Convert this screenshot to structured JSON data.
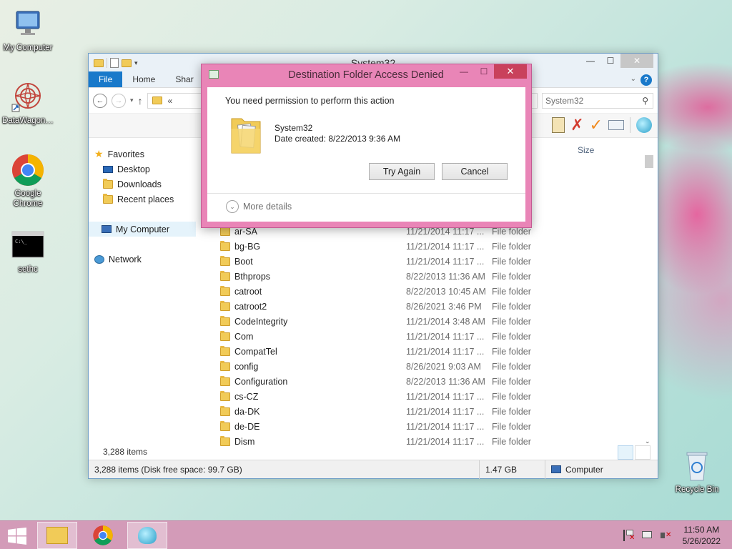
{
  "desktop": {
    "icons": [
      {
        "label": "My Computer",
        "icon": "computer-icon"
      },
      {
        "label": "DataWagon…",
        "icon": "datawagon-icon"
      },
      {
        "label": "Google Chrome",
        "icon": "chrome-icon"
      },
      {
        "label": "sethc",
        "icon": "console-icon"
      },
      {
        "label": "Recycle Bin",
        "icon": "recycle-bin-icon"
      }
    ]
  },
  "explorer": {
    "title": "System32",
    "tabs": [
      "File",
      "Home",
      "Shar"
    ],
    "address_prefix": "«",
    "search_placeholder": "System32",
    "column_size": "Size",
    "nav": {
      "favorites": "Favorites",
      "desktop": "Desktop",
      "downloads": "Downloads",
      "recent": "Recent places",
      "computer": "My Computer",
      "network": "Network"
    },
    "files": [
      {
        "name": "ar-SA",
        "date": "11/21/2014 11:17 ...",
        "type": "File folder"
      },
      {
        "name": "bg-BG",
        "date": "11/21/2014 11:17 ...",
        "type": "File folder"
      },
      {
        "name": "Boot",
        "date": "11/21/2014 11:17 ...",
        "type": "File folder"
      },
      {
        "name": "Bthprops",
        "date": "8/22/2013 11:36 AM",
        "type": "File folder"
      },
      {
        "name": "catroot",
        "date": "8/22/2013 10:45 AM",
        "type": "File folder"
      },
      {
        "name": "catroot2",
        "date": "8/26/2021 3:46 PM",
        "type": "File folder"
      },
      {
        "name": "CodeIntegrity",
        "date": "11/21/2014 3:48 AM",
        "type": "File folder"
      },
      {
        "name": "Com",
        "date": "11/21/2014 11:17 ...",
        "type": "File folder"
      },
      {
        "name": "CompatTel",
        "date": "11/21/2014 11:17 ...",
        "type": "File folder"
      },
      {
        "name": "config",
        "date": "8/26/2021 9:03 AM",
        "type": "File folder"
      },
      {
        "name": "Configuration",
        "date": "8/22/2013 11:36 AM",
        "type": "File folder"
      },
      {
        "name": "cs-CZ",
        "date": "11/21/2014 11:17 ...",
        "type": "File folder"
      },
      {
        "name": "da-DK",
        "date": "11/21/2014 11:17 ...",
        "type": "File folder"
      },
      {
        "name": "de-DE",
        "date": "11/21/2014 11:17 ...",
        "type": "File folder"
      },
      {
        "name": "Dism",
        "date": "11/21/2014 11:17 ...",
        "type": "File folder"
      }
    ],
    "item_count": "3,288 items",
    "status": {
      "summary": "3,288 items (Disk free space: 99.7 GB)",
      "size": "1.47 GB",
      "location": "Computer"
    }
  },
  "dialog": {
    "title": "Destination Folder Access Denied",
    "message": "You need permission to perform this action",
    "folder_name": "System32",
    "date_created": "Date created: 8/22/2013 9:36 AM",
    "try_again": "Try Again",
    "cancel": "Cancel",
    "more_details": "More details"
  },
  "taskbar": {
    "time": "11:50 AM",
    "date": "5/26/2022"
  },
  "colors": {
    "dialog_frame": "#e985b7",
    "close_button": "#c9415c",
    "file_tab": "#1979ca",
    "taskbar": "#d39bb8"
  }
}
